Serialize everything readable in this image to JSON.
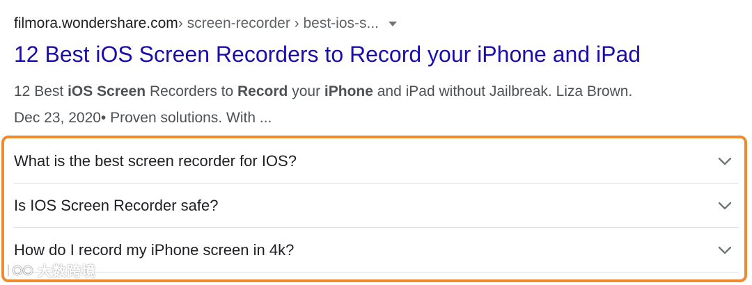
{
  "result": {
    "breadcrumb": {
      "domain": "filmora.wondershare.com",
      "path": " › screen-recorder › best-ios-s..."
    },
    "title": "12 Best iOS Screen Recorders to Record your iPhone and iPad",
    "snippet": {
      "t1": "12 Best ",
      "b1": "iOS Screen",
      "t2": " Recorders to ",
      "b2": "Record",
      "t3": " your ",
      "b3": "iPhone",
      "t4": " and iPad without Jailbreak. Liza Brown.",
      "line2": "Dec 23, 2020• Proven solutions. With ..."
    }
  },
  "faq": {
    "items": [
      {
        "question": "What is the best screen recorder for IOS?"
      },
      {
        "question": "Is IOS Screen Recorder safe?"
      },
      {
        "question": "How do I record my iPhone screen in 4k?"
      }
    ],
    "highlight_color": "#ef8a2f",
    "chevron_icon": "chevron-down-icon"
  },
  "watermark": {
    "text": "大数跨境"
  }
}
